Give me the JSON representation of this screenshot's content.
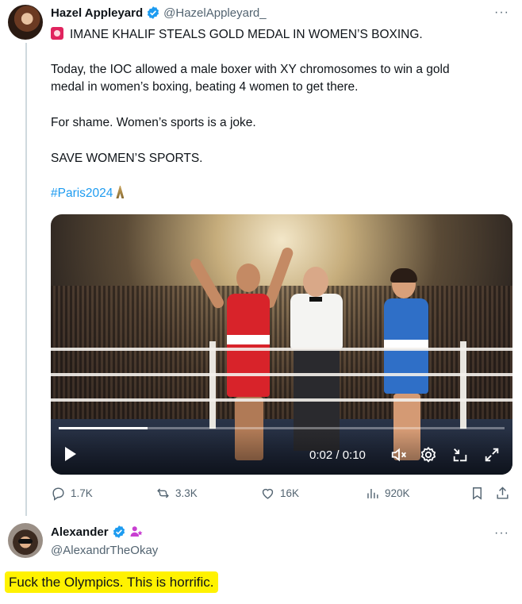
{
  "tweet": {
    "author_name": "Hazel Appleyard",
    "author_handle": "@HazelAppleyard_",
    "more_label": "···",
    "headline": "IMANE KHALIF STEALS GOLD MEDAL IN WOMEN’S BOXING.",
    "para1_line1": "Today, the IOC allowed a male boxer with XY chromosomes to win a gold",
    "para1_line2": "medal in women’s boxing, beating 4 women to get there.",
    "para2": "For shame. Women’s sports is a joke.",
    "para3": "SAVE WOMEN’S SPORTS.",
    "hashtag": "#Paris2024",
    "video": {
      "time_display": "0:02 / 0:10",
      "progress_fraction": 0.2
    },
    "stats": {
      "replies": "1.7K",
      "reposts": "3.3K",
      "likes": "16K",
      "views": "920K"
    }
  },
  "reply": {
    "author_name": "Alexander",
    "author_handle": "@AlexandrTheOkay",
    "more_label": "···",
    "text": "Fuck the Olympics. This is horrific."
  },
  "colors": {
    "accent": "#1d9bf0",
    "muted_text": "#536471",
    "highlight": "#fff200"
  },
  "icons": [
    "verified-badge-icon",
    "siren-icon",
    "eiffel-tower-icon",
    "play-icon",
    "mute-icon",
    "settings-icon",
    "exit-fullscreen-icon",
    "fullscreen-icon",
    "reply-icon",
    "repost-icon",
    "like-icon",
    "views-icon",
    "bookmark-icon",
    "share-icon",
    "affiliate-badge-icon"
  ]
}
